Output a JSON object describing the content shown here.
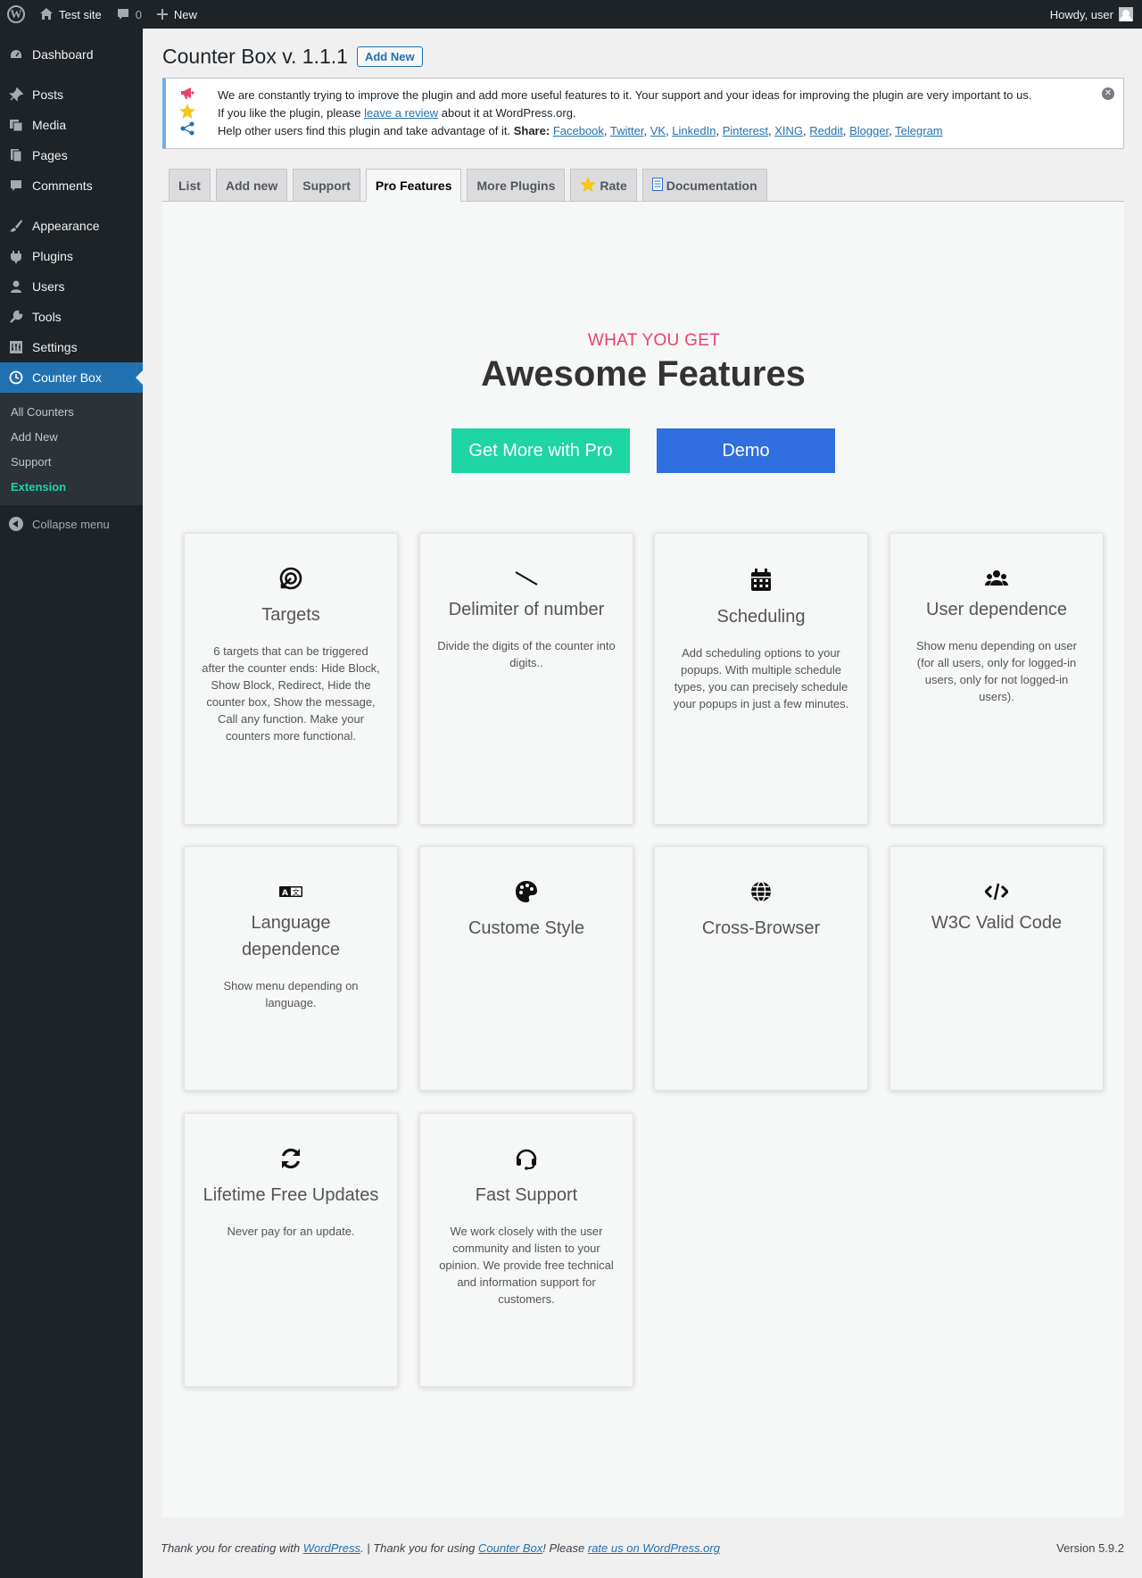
{
  "admin_bar": {
    "site_name": "Test site",
    "comments_count": "0",
    "new_label": "New",
    "howdy": "Howdy, user"
  },
  "sidebar": {
    "items": [
      {
        "label": "Dashboard",
        "icon": "dashboard-icon"
      },
      {
        "label": "Posts",
        "icon": "pin-icon"
      },
      {
        "label": "Media",
        "icon": "media-icon"
      },
      {
        "label": "Pages",
        "icon": "pages-icon"
      },
      {
        "label": "Comments",
        "icon": "comment-icon"
      },
      {
        "label": "Appearance",
        "icon": "brush-icon"
      },
      {
        "label": "Plugins",
        "icon": "plug-icon"
      },
      {
        "label": "Users",
        "icon": "user-icon"
      },
      {
        "label": "Tools",
        "icon": "wrench-icon"
      },
      {
        "label": "Settings",
        "icon": "settings-icon"
      },
      {
        "label": "Counter Box",
        "icon": "clock-icon"
      }
    ],
    "submenu": [
      "All Counters",
      "Add New",
      "Support",
      "Extension"
    ],
    "collapse_label": "Collapse menu"
  },
  "page": {
    "title": "Counter Box v. 1.1.1",
    "add_new": "Add New"
  },
  "notice": {
    "line1": "We are constantly trying to improve the plugin and add more useful features to it. Your support and your ideas for improving the plugin are very important to us.",
    "line2_pre": "If you like the plugin, please ",
    "line2_link": "leave a review",
    "line2_post": " about it at WordPress.org.",
    "line3_pre": "Help other users find this plugin and take advantage of it. ",
    "line3_bold": "Share:",
    "share_links": [
      "Facebook",
      "Twitter",
      "VK",
      "LinkedIn",
      "Pinterest",
      "XING",
      "Reddit",
      "Blogger",
      "Telegram"
    ]
  },
  "tabs": [
    "List",
    "Add new",
    "Support",
    "Pro Features",
    "More Plugins",
    "Rate",
    "Documentation"
  ],
  "hero": {
    "eyebrow": "WHAT YOU GET",
    "headline": "Awesome Features",
    "pro_button": "Get More with Pro",
    "demo_button": "Demo"
  },
  "features": [
    {
      "title": "Targets",
      "desc": "6 targets that can be triggered after the counter ends: Hide Block, Show Block, Redirect, Hide the counter box, Show the message, Call any function. Make your counters more functional.",
      "icon": "target-icon"
    },
    {
      "title": "Delimiter of number",
      "desc": "Divide the digits of the counter into digits..",
      "icon": "slash-icon"
    },
    {
      "title": "Scheduling",
      "desc": "Add scheduling options to your popups. With multiple schedule types, you can precisely schedule your popups in just a few minutes.",
      "icon": "calendar-icon"
    },
    {
      "title": "User dependence",
      "desc": "Show menu depending on user (for all users, only for logged-in users, only for not logged-in users).",
      "icon": "users-icon"
    },
    {
      "title": "Language dependence",
      "desc": "Show menu depending on language.",
      "icon": "language-icon"
    },
    {
      "title": "Custome Style",
      "desc": "",
      "icon": "palette-icon"
    },
    {
      "title": "Cross-Browser",
      "desc": "",
      "icon": "globe-icon"
    },
    {
      "title": "W3C Valid Code",
      "desc": "",
      "icon": "code-icon"
    },
    {
      "title": "Lifetime Free Updates",
      "desc": "Never pay for an update.",
      "icon": "refresh-icon"
    },
    {
      "title": "Fast Support",
      "desc": "We work closely with the user community and listen to your opinion. We provide free technical and information support for customers.",
      "icon": "headset-icon"
    }
  ],
  "footer": {
    "pre": "Thank you for creating with ",
    "wp_link": "WordPress",
    "mid": ". | Thank you for using ",
    "cb_link": "Counter Box",
    "mid2": "! Please ",
    "rate_link": "rate us on WordPress.org",
    "version": "Version 5.9.2"
  },
  "colors": {
    "accent_green": "#1ed5a4",
    "accent_blue": "#2f6fde",
    "eyebrow_pink": "#e8436b",
    "wp_blue": "#2271b1"
  }
}
